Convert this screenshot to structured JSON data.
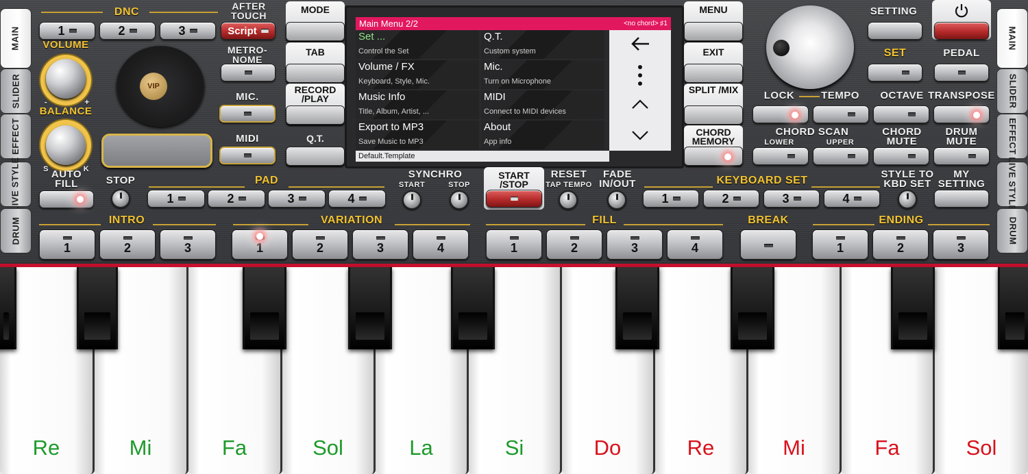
{
  "tabs_left": [
    "MAIN",
    "SLIDER",
    "EFFECT",
    "LIVE STYLE",
    "DRUM"
  ],
  "tabs_right": [
    "MAIN",
    "SLIDER",
    "EFFECT",
    "LIVE STYLE",
    "DRUM"
  ],
  "dnc": {
    "label": "DNC",
    "buttons": [
      "1",
      "2",
      "3"
    ],
    "after_touch": "AFTER TOUCH",
    "script": "Script"
  },
  "volume": "VOLUME",
  "balance": "BALANCE",
  "balance_minus": "-",
  "balance_plus": "+",
  "auto_fill": "AUTO FILL",
  "s_label": "S",
  "k_label": "K",
  "metronome": "METRO- NOME",
  "mic": "MIC.",
  "midi": "MIDI",
  "vip": "VIP",
  "left_col": {
    "mode": "MODE",
    "tab": "TAB",
    "record": "RECORD /PLAY",
    "qt": "Q.T."
  },
  "right_col": {
    "menu": "MENU",
    "exit": "EXIT",
    "split": "SPLIT /MIX",
    "chord_memory": "CHORD MEMORY"
  },
  "screen": {
    "title": "Main Menu  2/2",
    "status": "<no chord>  ♯1",
    "items": [
      {
        "title": "Set ...",
        "desc": "Control the Set"
      },
      {
        "title": "Q.T.",
        "desc": "Custom system"
      },
      {
        "title": "Volume / FX",
        "desc": "Keyboard, Style, Mic."
      },
      {
        "title": "Mic.",
        "desc": "Turn on Microphone"
      },
      {
        "title": "Music Info",
        "desc": "Title, Album, Artist, ..."
      },
      {
        "title": "MIDI",
        "desc": "Connect to MIDI devices"
      },
      {
        "title": "Export to MP3",
        "desc": "Save Music to MP3"
      },
      {
        "title": "About",
        "desc": "App info"
      }
    ],
    "footer": "Default.Template"
  },
  "setting": "SETTING",
  "set": "SET",
  "pedal": "PEDAL",
  "row2": {
    "lock": "LOCK",
    "tempo": "TEMPO",
    "octave": "OCTAVE",
    "transpose": "TRANSPOSE"
  },
  "row3": {
    "chord_scan": "CHORD SCAN",
    "lower": "LOWER",
    "upper": "UPPER",
    "chord_mute": "CHORD MUTE",
    "drum_mute": "DRUM MUTE"
  },
  "row4": {
    "stop": "STOP",
    "pad": "PAD",
    "pad_buttons": [
      "1",
      "2",
      "3",
      "4"
    ],
    "synchro": "SYNCHRO",
    "start": "START",
    "stop2": "STOP",
    "start_stop": "START /STOP",
    "reset": "RESET",
    "tap_tempo": "TAP TEMPO",
    "fade": "FADE IN/OUT",
    "keyboard_set": "KEYBOARD SET",
    "kbd_buttons": [
      "1",
      "2",
      "3",
      "4"
    ],
    "style_to_kbd": "STYLE TO KBD SET",
    "my_setting": "MY SETTING"
  },
  "row5": {
    "intro": "INTRO",
    "intro_buttons": [
      "1",
      "2",
      "3"
    ],
    "variation": "VARIATION",
    "variation_buttons": [
      "1",
      "2",
      "3",
      "4"
    ],
    "fill": "FILL",
    "fill_buttons": [
      "1",
      "2",
      "3",
      "4"
    ],
    "break": "BREAK",
    "ending": "ENDING",
    "ending_buttons": [
      "1",
      "2",
      "3"
    ]
  },
  "keys": [
    {
      "note": "Re",
      "color": "#1d9a2a"
    },
    {
      "note": "Mi",
      "color": "#1d9a2a"
    },
    {
      "note": "Fa",
      "color": "#1d9a2a"
    },
    {
      "note": "Sol",
      "color": "#1d9a2a"
    },
    {
      "note": "La",
      "color": "#1d9a2a"
    },
    {
      "note": "Si",
      "color": "#1d9a2a"
    },
    {
      "note": "Do",
      "color": "#d8121c"
    },
    {
      "note": "Re",
      "color": "#d8121c"
    },
    {
      "note": "Mi",
      "color": "#d8121c"
    },
    {
      "note": "Fa",
      "color": "#d8121c"
    },
    {
      "note": "Sol",
      "color": "#d8121c"
    }
  ]
}
